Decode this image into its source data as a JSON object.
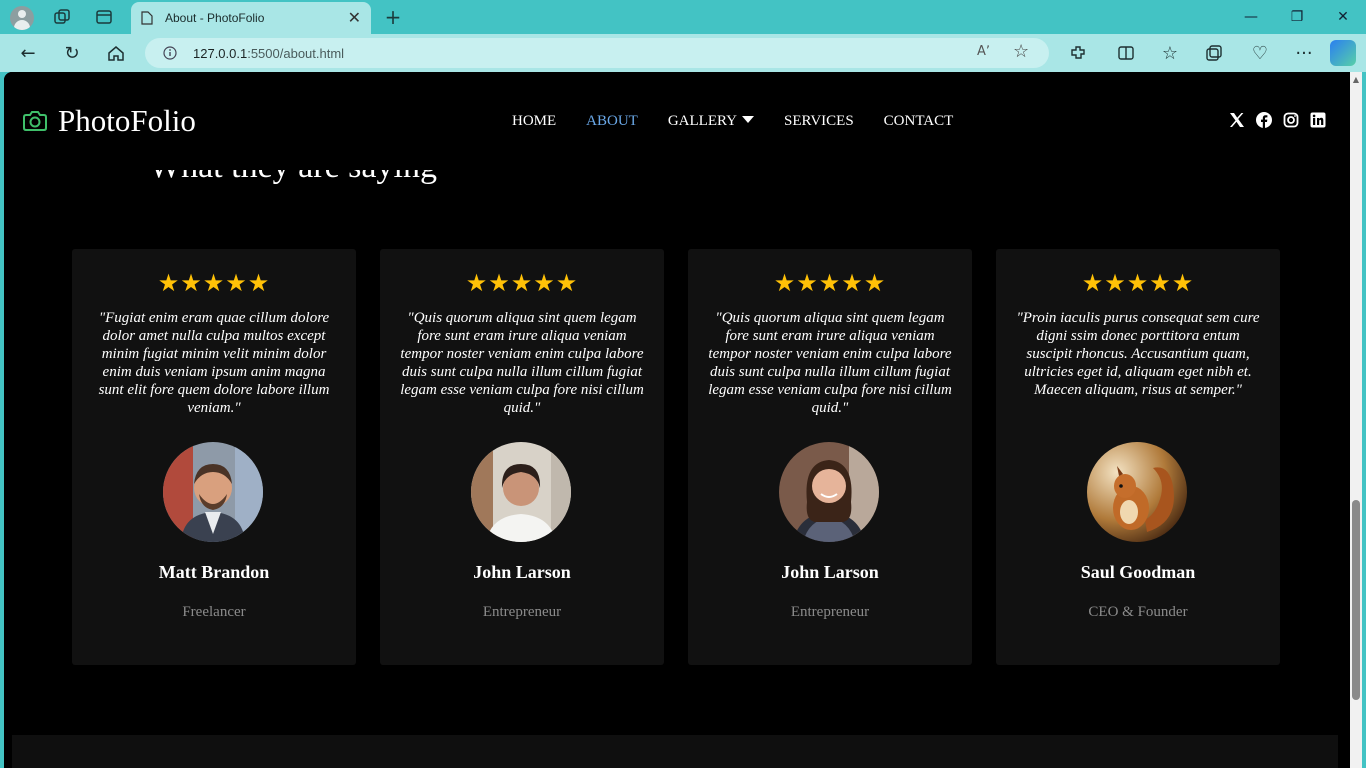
{
  "browser": {
    "tab_title": "About - PhotoFolio",
    "url_host": "127.0.0.1",
    "url_path": ":5500/about.html",
    "accent": "#43c3c4"
  },
  "site": {
    "brand": "PhotoFolio",
    "nav": [
      "HOME",
      "ABOUT",
      "GALLERY",
      "SERVICES",
      "CONTACT"
    ],
    "active_nav": "ABOUT",
    "social_icons": [
      "x-icon",
      "facebook-icon",
      "instagram-icon",
      "linkedin-icon"
    ]
  },
  "testimonials": {
    "heading": "What they are saying",
    "items": [
      {
        "stars": "★★★★★",
        "quote": "\"Fugiat enim eram quae cillum dolore dolor amet nulla culpa multos except minim fugiat minim velit minim dolor enim duis veniam ipsum anim magna sunt elit fore quem dolore labore illum veniam.\"",
        "name": "Matt Brandon",
        "role": "Freelancer"
      },
      {
        "stars": "★★★★★",
        "quote": "\"Quis quorum aliqua sint quem legam fore sunt eram irure aliqua veniam tempor noster veniam enim culpa labore duis sunt culpa nulla illum cillum fugiat legam esse veniam culpa fore nisi cillum quid.\"",
        "name": "John Larson",
        "role": "Entrepreneur"
      },
      {
        "stars": "★★★★★",
        "quote": "\"Quis quorum aliqua sint quem legam fore sunt eram irure aliqua veniam tempor noster veniam enim culpa labore duis sunt culpa nulla illum cillum fugiat legam esse veniam culpa fore nisi cillum quid.\"",
        "name": "John Larson",
        "role": "Entrepreneur"
      },
      {
        "stars": "★★★★★",
        "quote": "\"Proin iaculis purus consequat sem cure digni ssim donec porttitora entum suscipit rhoncus. Accusantium quam, ultricies eget id, aliquam eget nibh et. Maecen aliquam, risus at semper.\"",
        "name": "Saul Goodman",
        "role": "CEO & Founder"
      }
    ]
  }
}
